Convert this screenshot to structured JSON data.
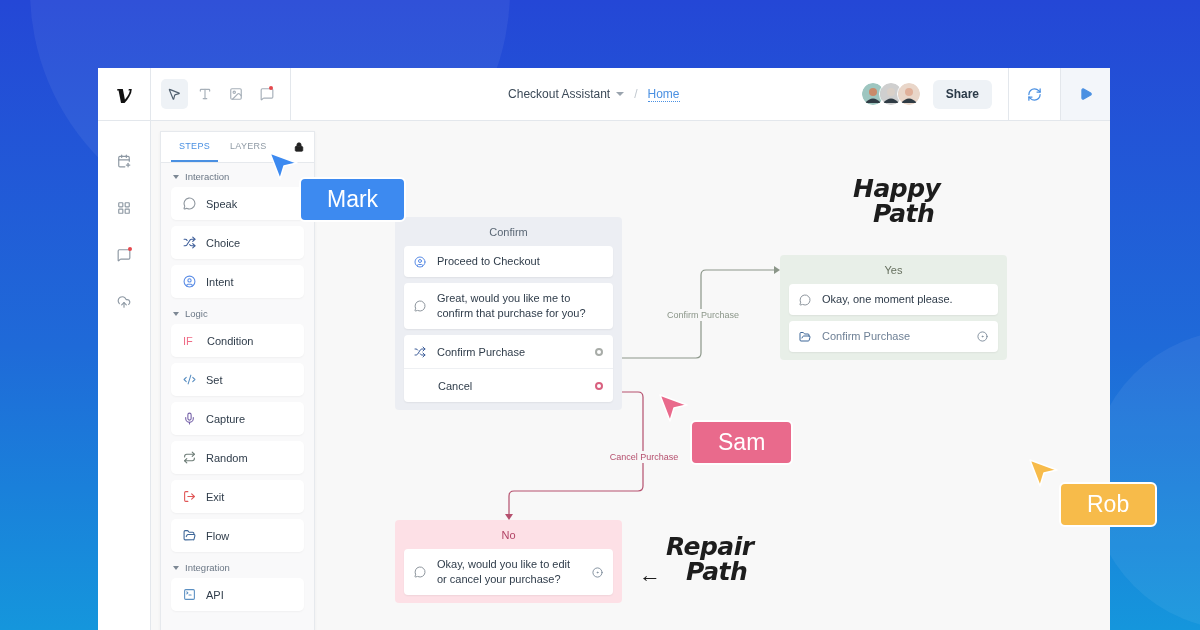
{
  "topbar": {
    "logo": "v",
    "tools": [
      {
        "selected": true
      },
      {
        "selected": false
      },
      {
        "selected": false
      },
      {
        "selected": false
      }
    ],
    "project": "Checkout Assistant",
    "separator": "/",
    "page": "Home",
    "share": "Share"
  },
  "panel": {
    "tabs": [
      {
        "label": "STEPS",
        "selected": true
      },
      {
        "label": "LAYERS",
        "selected": false
      }
    ],
    "sections": [
      {
        "title": "Interaction",
        "expanded": true,
        "steps": [
          {
            "label": "Speak",
            "kind": "speak"
          },
          {
            "label": "Choice",
            "kind": "choice"
          },
          {
            "label": "Intent",
            "kind": "intent"
          }
        ]
      },
      {
        "title": "Logic",
        "expanded": true,
        "steps": [
          {
            "label": "Condition",
            "kind": "condition",
            "badge": "IF"
          },
          {
            "label": "Set",
            "kind": "set"
          },
          {
            "label": "Capture",
            "kind": "capture"
          },
          {
            "label": "Random",
            "kind": "random"
          },
          {
            "label": "Exit",
            "kind": "exit"
          },
          {
            "label": "Flow",
            "kind": "flow"
          }
        ]
      },
      {
        "title": "Integration",
        "expanded": true,
        "steps": [
          {
            "label": "API",
            "kind": "api"
          }
        ]
      }
    ]
  },
  "blocks": [
    {
      "title": "Confirm",
      "kind": "neutral",
      "items": [
        {
          "kind": "intent",
          "text": "Proceed to Checkout",
          "linked": false
        },
        {
          "kind": "speak",
          "text": "Great, would you like me to confirm that purchase for you?",
          "linked": false
        },
        {
          "kind": "choice",
          "rows": [
            {
              "text": "Confirm Purchase",
              "icon": true,
              "color": "#a8aca8"
            },
            {
              "text": "Cancel",
              "icon": false,
              "color": "#d9607f"
            }
          ]
        }
      ]
    },
    {
      "title": "Yes",
      "kind": "yes",
      "items": [
        {
          "kind": "speak",
          "text": "Okay, one moment please.",
          "linked": false
        },
        {
          "kind": "flow",
          "text": "Confirm Purchase",
          "linked": true
        }
      ]
    },
    {
      "title": "No",
      "kind": "no",
      "items": [
        {
          "kind": "speak",
          "text": "Okay, would you like to edit or cancel your purchase?",
          "linked": true
        }
      ]
    }
  ],
  "connections": [
    {
      "label": "Confirm Purchase",
      "kind": "yes"
    },
    {
      "label": "Cancel Purchase",
      "kind": "no"
    }
  ],
  "notes": [
    {
      "lines": [
        "Happy",
        "Path"
      ]
    },
    {
      "lines": [
        "Repair",
        "Path"
      ],
      "arrow": "←"
    }
  ],
  "cursors": [
    {
      "name": "Mark",
      "color": "#3d8af0"
    },
    {
      "name": "Sam",
      "color": "#e96a8c"
    },
    {
      "name": "Rob",
      "color": "#f7bb4a"
    }
  ]
}
